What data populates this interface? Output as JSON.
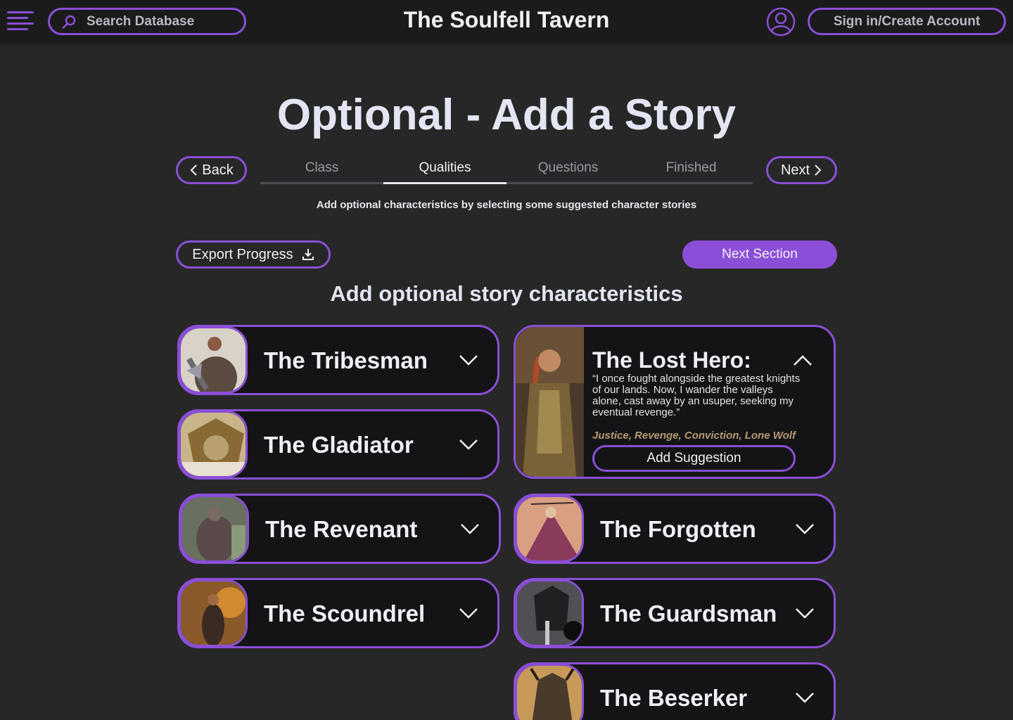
{
  "header": {
    "search_placeholder": "Search Database",
    "site_title": "The Soulfell Tavern",
    "signin_label": "Sign in/Create Account"
  },
  "page": {
    "heading": "Optional - Add a Story",
    "back_label": "Back",
    "next_label": "Next",
    "tabs": [
      {
        "label": "Class",
        "active": false
      },
      {
        "label": "Qualities",
        "active": true
      },
      {
        "label": "Questions",
        "active": false
      },
      {
        "label": "Finished",
        "active": false
      }
    ],
    "subtitle": "Add optional characteristics by selecting some suggested character stories",
    "export_label": "Export Progress",
    "next_section_label": "Next Section",
    "section_heading": "Add optional story characteristics"
  },
  "stories": [
    {
      "name": "The Tribesman",
      "expanded": false
    },
    {
      "name": "The Gladiator",
      "expanded": false
    },
    {
      "name": "The Revenant",
      "expanded": false
    },
    {
      "name": "The Scoundrel",
      "expanded": false
    },
    {
      "name": "The Lost Hero:",
      "expanded": true,
      "quote": "“I once fought alongside the greatest knights of our lands. Now, I wander the valleys alone, cast away by an usuper, seeking my eventual revenge.”",
      "tags": "Justice, Revenge, Conviction, Lone Wolf",
      "action_label": "Add Suggestion"
    },
    {
      "name": "The Forgotten",
      "expanded": false
    },
    {
      "name": "The Guardsman",
      "expanded": false
    },
    {
      "name": "The Beserker",
      "expanded": false
    }
  ],
  "colors": {
    "accent": "#8a4fd6",
    "background": "#272727",
    "card": "#141416",
    "tags": "#b59a72"
  }
}
